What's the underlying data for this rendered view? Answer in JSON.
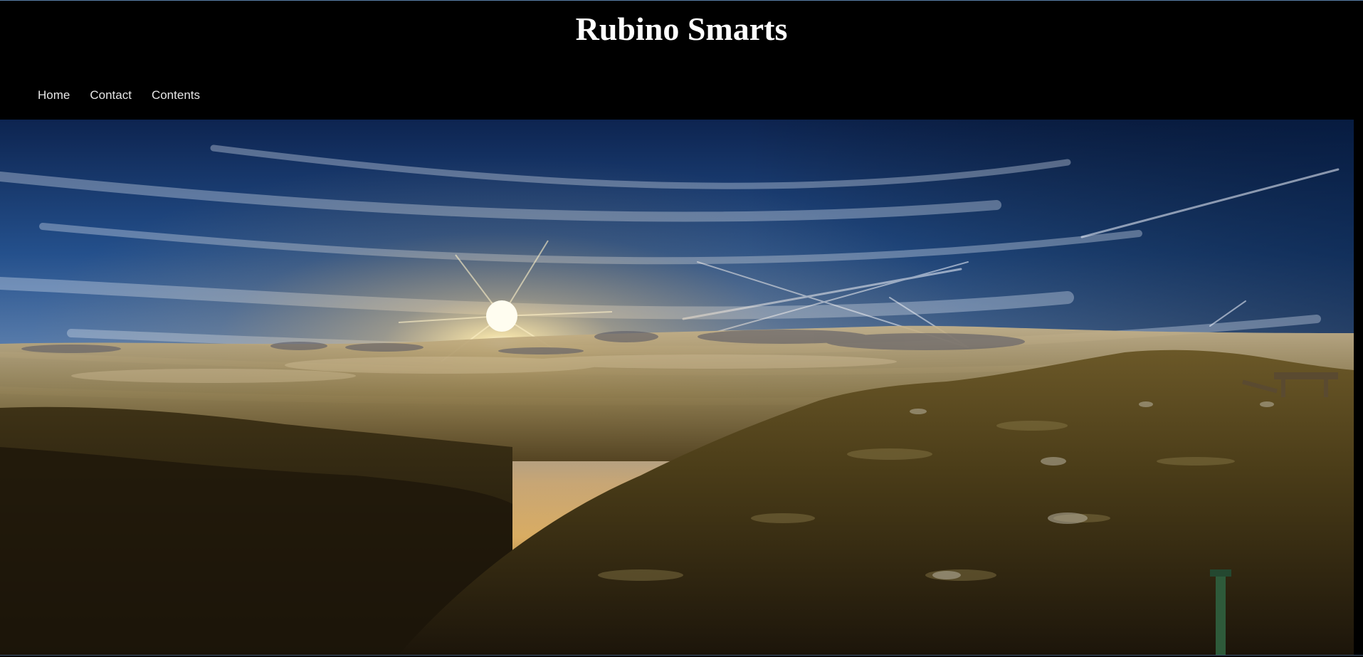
{
  "site": {
    "title": "Rubino Smarts"
  },
  "nav": {
    "items": [
      {
        "label": "Home"
      },
      {
        "label": "Contact"
      },
      {
        "label": "Contents"
      }
    ]
  },
  "hero": {
    "image_subject": "sunrise-over-clouds-mountain-landscape",
    "colors": {
      "sky_top": "#0c2a5c",
      "sky_mid": "#3a6aa8",
      "horizon": "#e8b86a",
      "sun": "#fff6d8",
      "ground": "#3a2e12"
    }
  },
  "colors": {
    "header_bg": "#000000",
    "title_text": "#ffffff",
    "nav_text": "#e6e6e6"
  }
}
